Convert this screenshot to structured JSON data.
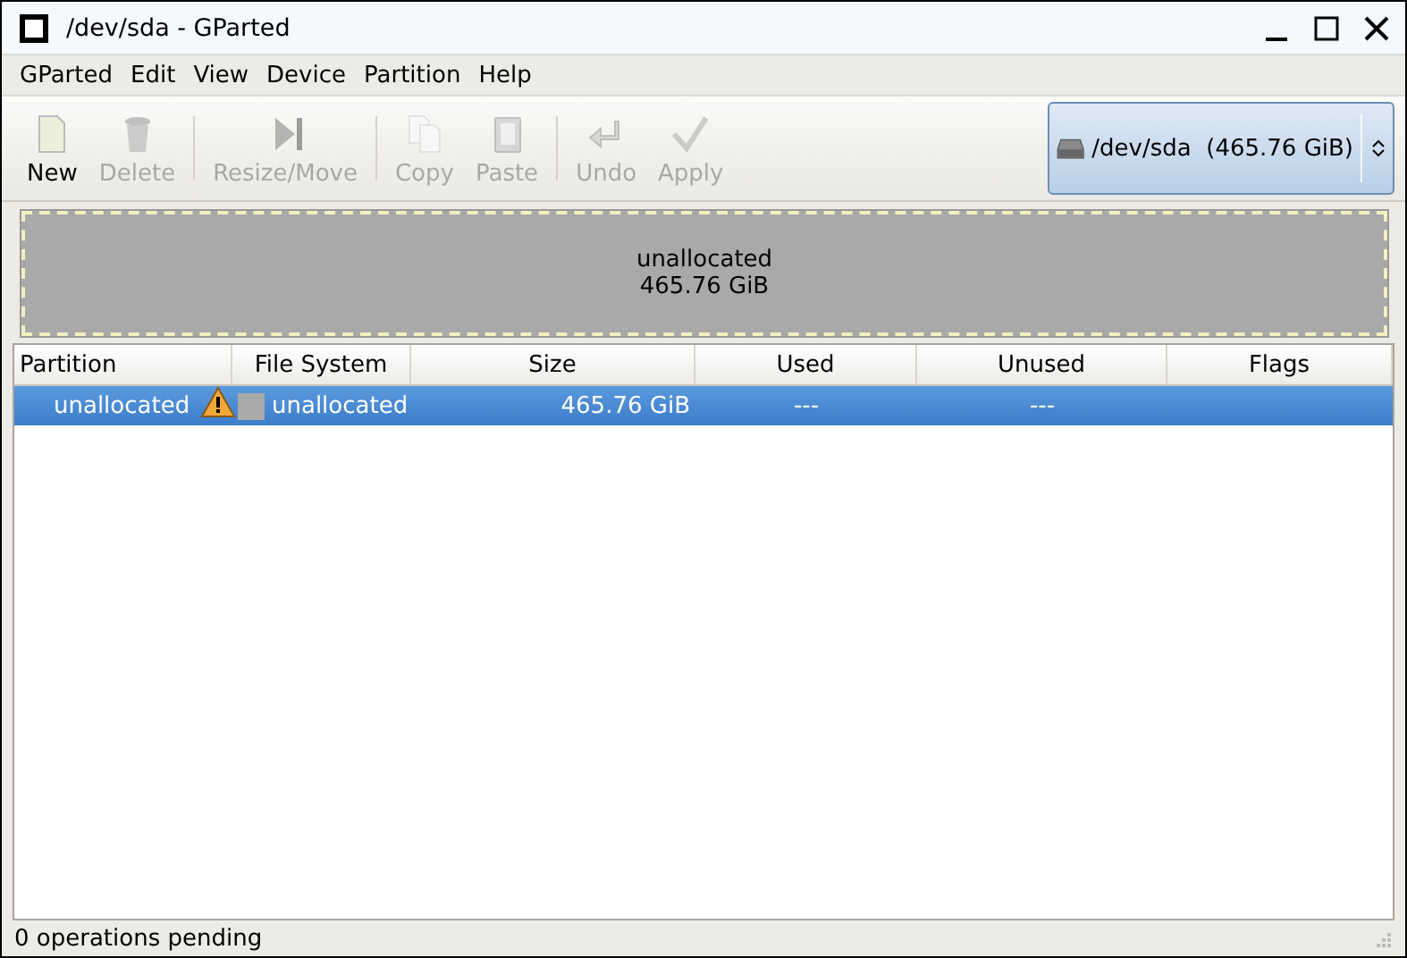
{
  "window": {
    "title": "/dev/sda - GParted"
  },
  "menu": [
    "GParted",
    "Edit",
    "View",
    "Device",
    "Partition",
    "Help"
  ],
  "toolbar": [
    {
      "kind": "new",
      "label": "New",
      "disabled": false
    },
    {
      "kind": "delete",
      "label": "Delete",
      "disabled": true
    },
    {
      "kind": "separator"
    },
    {
      "kind": "resize",
      "label": "Resize/Move",
      "disabled": true
    },
    {
      "kind": "separator"
    },
    {
      "kind": "copy",
      "label": "Copy",
      "disabled": true
    },
    {
      "kind": "paste",
      "label": "Paste",
      "disabled": true
    },
    {
      "kind": "separator"
    },
    {
      "kind": "undo",
      "label": "Undo",
      "disabled": true
    },
    {
      "kind": "apply",
      "label": "Apply",
      "disabled": true
    }
  ],
  "device": {
    "path": "/dev/sda",
    "size": "(465.76 GiB)"
  },
  "disk_map": [
    {
      "name": "unallocated",
      "size": "465.76 GiB",
      "color": "#a9a9a9"
    }
  ],
  "table": {
    "columns": [
      "Partition",
      "File System",
      "Size",
      "Used",
      "Unused",
      "Flags"
    ],
    "rows": [
      {
        "partition": "unallocated",
        "warning": true,
        "color": "#a9a9a9",
        "file_system": "unallocated",
        "size": "465.76 GiB",
        "used": "---",
        "unused": "---",
        "selected": true
      }
    ]
  },
  "status_bar": "0 operations pending"
}
